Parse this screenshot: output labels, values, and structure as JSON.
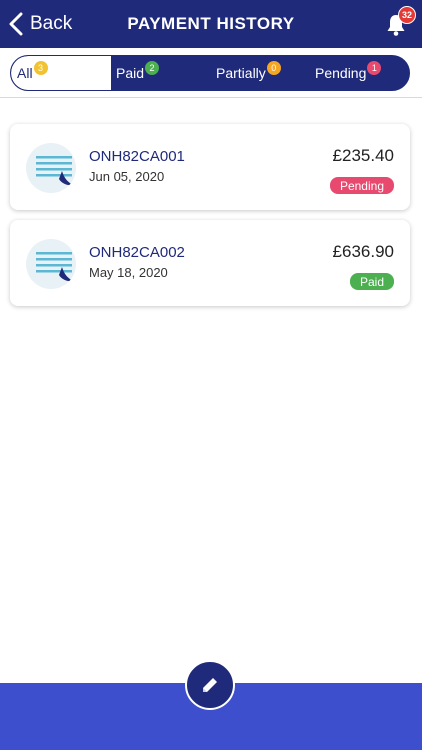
{
  "header": {
    "back_label": "Back",
    "title": "PAYMENT HISTORY",
    "notification_count": "32"
  },
  "tabs": [
    {
      "label": "All",
      "count": "3",
      "badge_color": "#f2c230",
      "active": true
    },
    {
      "label": "Paid",
      "count": "2",
      "badge_color": "#4caf50",
      "active": false
    },
    {
      "label": "Partially",
      "count": "0",
      "badge_color": "#f5a623",
      "active": false
    },
    {
      "label": "Pending",
      "count": "1",
      "badge_color": "#e84a6f",
      "active": false
    }
  ],
  "payments": [
    {
      "reference": "ONH82CA001",
      "date": "Jun 05, 2020",
      "amount": "£235.40",
      "status": "Pending",
      "status_color": "#e84a6f"
    },
    {
      "reference": "ONH82CA002",
      "date": "May 18, 2020",
      "amount": "£636.90",
      "status": "Paid",
      "status_color": "#4caf50"
    }
  ],
  "colors": {
    "primary": "#1f2a7a",
    "bottom_bar": "#3e4fce"
  },
  "icons": {
    "back": "chevron-left-icon",
    "bell": "bell-icon",
    "fab": "pencil-icon",
    "logo": "company-logo-icon"
  }
}
